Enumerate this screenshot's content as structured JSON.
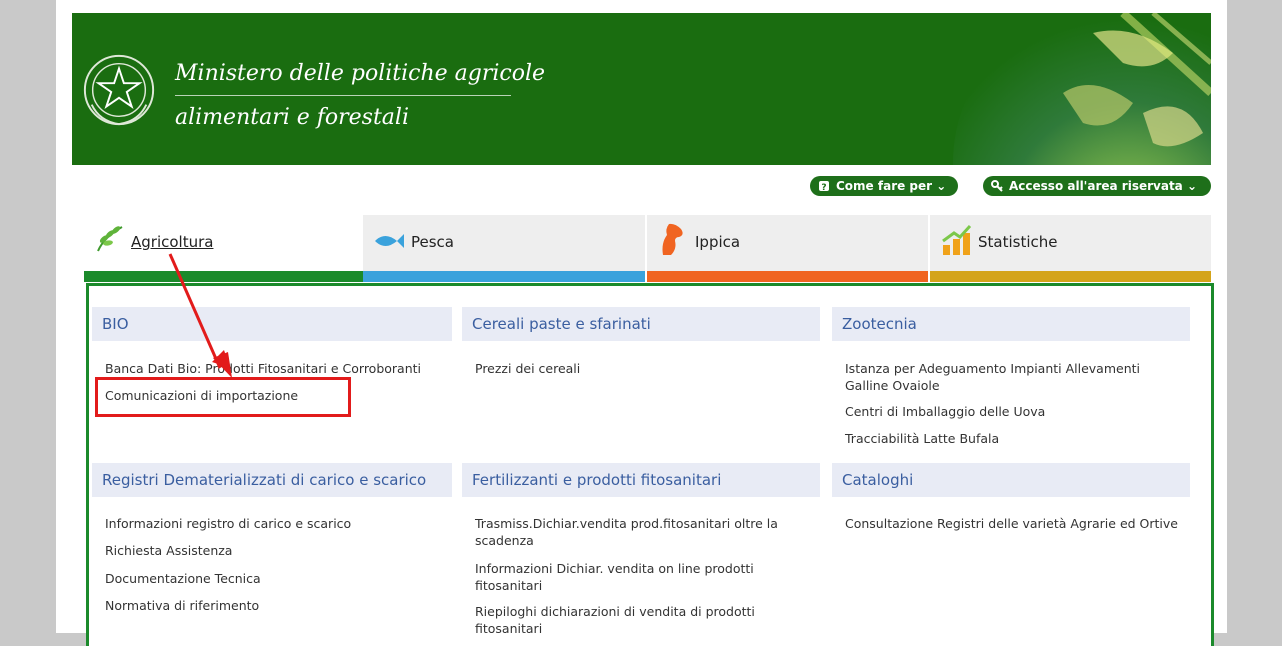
{
  "header": {
    "ministry_line1": "Ministero delle politiche agricole",
    "ministry_line2": "alimentari e forestali"
  },
  "utility": {
    "come_fare": "Come fare per",
    "accesso": "Accesso all'area riservata"
  },
  "tabs": [
    {
      "label": "Agricoltura",
      "icon": "wheat-icon",
      "color": "#1b8a2b"
    },
    {
      "label": "Pesca",
      "icon": "fish-icon",
      "color": "#3aa2dc"
    },
    {
      "label": "Ippica",
      "icon": "horse-icon",
      "color": "#f06421"
    },
    {
      "label": "Statistiche",
      "icon": "bar-chart-icon",
      "color": "#d4a41a"
    }
  ],
  "sections": {
    "bio": {
      "title": "BIO",
      "links": [
        "Banca Dati Bio: Prodotti Fitosanitari e Corroboranti",
        "Comunicazioni di importazione"
      ]
    },
    "cereali": {
      "title": "Cereali paste e sfarinati",
      "links": [
        "Prezzi dei cereali"
      ]
    },
    "zootecnia": {
      "title": "Zootecnia",
      "links": [
        "Istanza per Adeguamento Impianti Allevamenti Galline Ovaiole",
        "Centri di Imballaggio delle Uova",
        "Tracciabilità Latte Bufala"
      ]
    },
    "registri": {
      "title": "Registri Dematerializzati di carico e scarico",
      "links": [
        "Informazioni registro di carico e scarico",
        "Richiesta Assistenza",
        "Documentazione Tecnica",
        "Normativa di riferimento"
      ]
    },
    "fertilizzanti": {
      "title": "Fertilizzanti e prodotti fitosanitari",
      "links": [
        "Trasmiss.Dichiar.vendita prod.fitosanitari oltre la scadenza",
        "Informazioni Dichiar. vendita on line prodotti fitosanitari",
        "Riepiloghi dichiarazioni di vendita di prodotti fitosanitari"
      ]
    },
    "cataloghi": {
      "title": "Cataloghi",
      "links": [
        "Consultazione Registri delle varietà Agrarie ed Ortive"
      ]
    }
  },
  "colors": {
    "brand_green": "#1a6d10",
    "annotation_red": "#e21b1b",
    "section_heading": "#3a5ea0"
  }
}
